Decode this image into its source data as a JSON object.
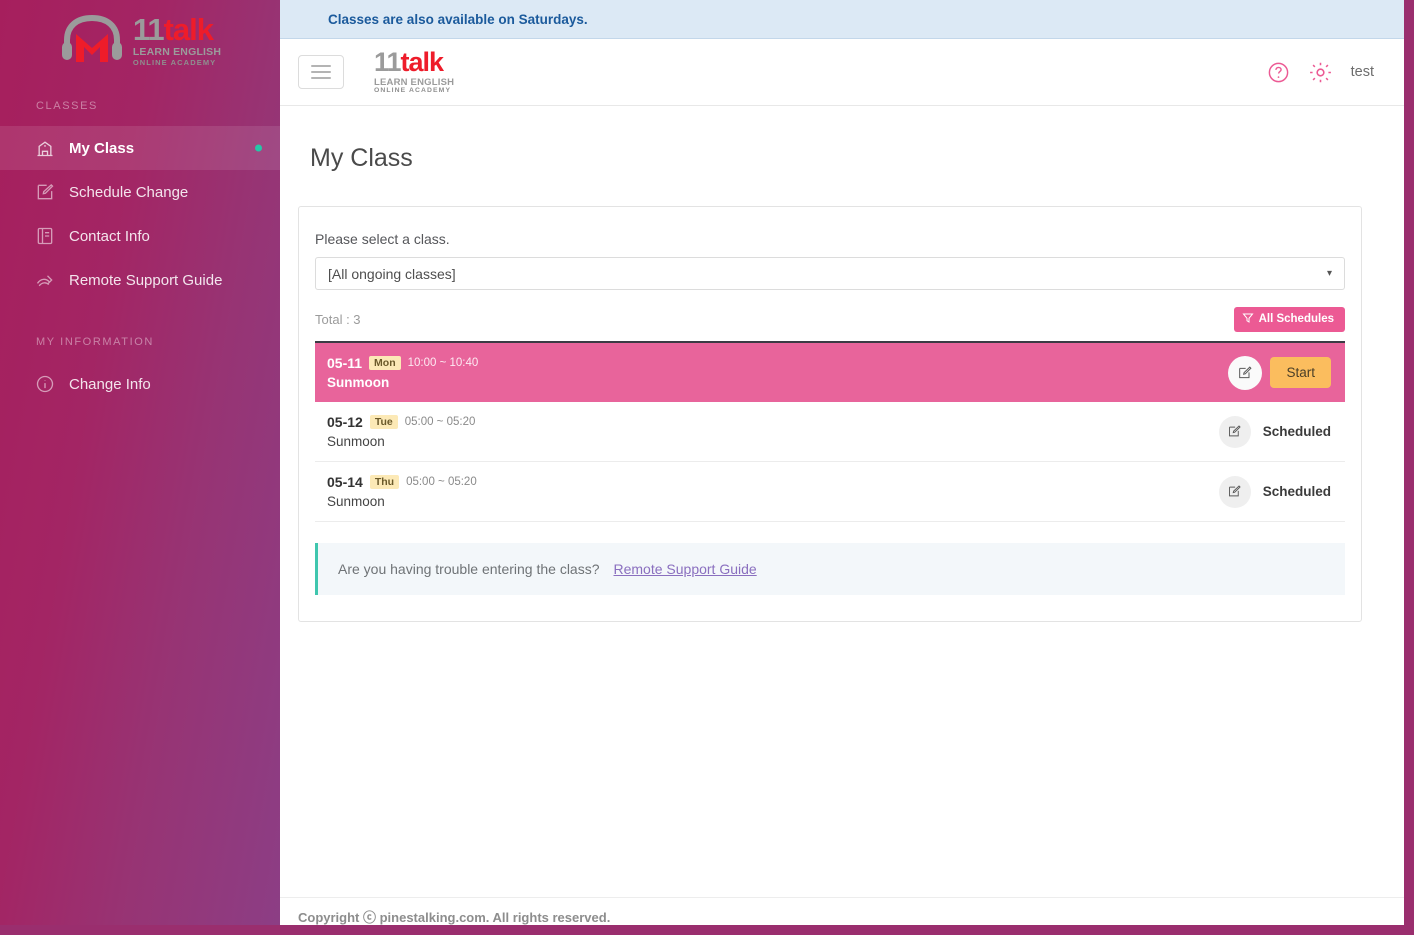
{
  "brand": {
    "logo_part1": "11",
    "logo_part2": "talk",
    "subtitle1": "LEARN ENGLISH",
    "subtitle2": "ONLINE ACADEMY",
    "accent_pink": "#ec5a94",
    "accent_red": "#ee1c2a",
    "sidebar_gradient_start": "#a61f5d",
    "sidebar_gradient_end": "#8c3e85",
    "badge_teal": "#25c7a8",
    "start_orange": "#fbbd5e"
  },
  "sidebar": {
    "groups": [
      {
        "label": "CLASSES",
        "items": [
          {
            "label": "My Class",
            "icon": "school-icon",
            "active": true,
            "badge": true
          },
          {
            "label": "Schedule Change",
            "icon": "edit-square-icon",
            "active": false,
            "badge": false
          },
          {
            "label": "Contact Info",
            "icon": "book-icon",
            "active": false,
            "badge": false
          },
          {
            "label": "Remote Support Guide",
            "icon": "signal-wave-icon",
            "active": false,
            "badge": false
          }
        ]
      },
      {
        "label": "MY INFORMATION",
        "items": [
          {
            "label": "Change Info",
            "icon": "info-circle-icon",
            "active": false,
            "badge": false
          }
        ]
      }
    ]
  },
  "notice": {
    "text": "Classes are also available on Saturdays."
  },
  "topbar": {
    "menu_icon": "hamburger-icon",
    "help_icon": "question-circle-icon",
    "settings_icon": "gear-icon",
    "user_name": "test"
  },
  "page": {
    "title": "My Class"
  },
  "class_selector": {
    "label": "Please select a class.",
    "selected_value": "[All ongoing classes]",
    "caret": "▾",
    "total_label": "Total : 3",
    "all_schedules_label": "All Schedules",
    "filter_icon": "funnel-icon"
  },
  "classes": [
    {
      "date": "05-11",
      "day": "Mon",
      "time": "10:00 ~ 10:40",
      "teacher": "Sunmoon",
      "active": true,
      "action_label": "Start",
      "edit_icon": "edit-pencil-icon"
    },
    {
      "date": "05-12",
      "day": "Tue",
      "time": "05:00 ~ 05:20",
      "teacher": "Sunmoon",
      "active": false,
      "status": "Scheduled",
      "edit_icon": "edit-pencil-icon"
    },
    {
      "date": "05-14",
      "day": "Thu",
      "time": "05:00 ~ 05:20",
      "teacher": "Sunmoon",
      "active": false,
      "status": "Scheduled",
      "edit_icon": "edit-pencil-icon"
    }
  ],
  "help_box": {
    "question": "Are you having trouble entering the class?",
    "link_label": "Remote Support Guide"
  },
  "footer": {
    "text": "Copyright ⓒ pinestalking.com. All rights reserved."
  }
}
